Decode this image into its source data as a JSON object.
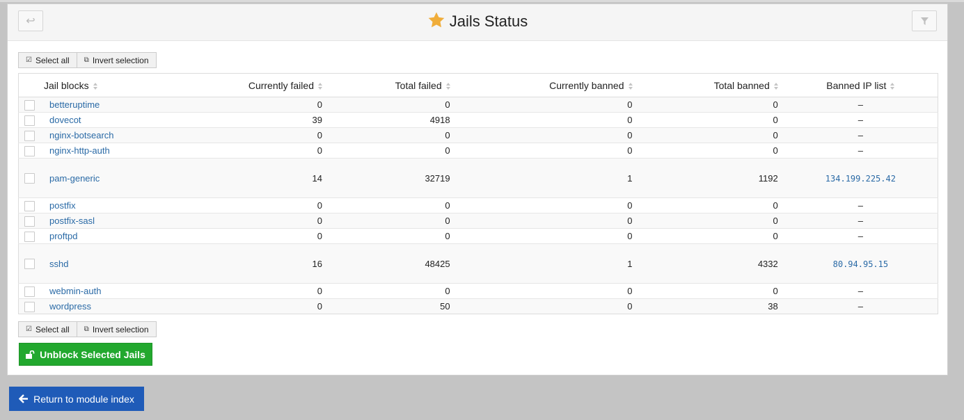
{
  "header": {
    "title": "Jails Status",
    "back_icon": "undo-arrow-icon",
    "filter_icon": "filter-icon",
    "title_icon": "star-icon",
    "star_color": "#f0ad3a"
  },
  "selection": {
    "select_all": "Select all",
    "invert": "Invert selection"
  },
  "table": {
    "columns": [
      "Jail blocks",
      "Currently failed",
      "Total failed",
      "Currently banned",
      "Total banned",
      "Banned IP list"
    ],
    "rows": [
      {
        "name": "betteruptime",
        "cf": "0",
        "tf": "0",
        "cb": "0",
        "tb": "0",
        "ip": "–"
      },
      {
        "name": "dovecot",
        "cf": "39",
        "tf": "4918",
        "cb": "0",
        "tb": "0",
        "ip": "–"
      },
      {
        "name": "nginx-botsearch",
        "cf": "0",
        "tf": "0",
        "cb": "0",
        "tb": "0",
        "ip": "–"
      },
      {
        "name": "nginx-http-auth",
        "cf": "0",
        "tf": "0",
        "cb": "0",
        "tb": "0",
        "ip": "–"
      },
      {
        "name": "pam-generic",
        "cf": "14",
        "tf": "32719",
        "cb": "1",
        "tb": "1192",
        "ip": "134.199.225.42"
      },
      {
        "name": "postfix",
        "cf": "0",
        "tf": "0",
        "cb": "0",
        "tb": "0",
        "ip": "–"
      },
      {
        "name": "postfix-sasl",
        "cf": "0",
        "tf": "0",
        "cb": "0",
        "tb": "0",
        "ip": "–"
      },
      {
        "name": "proftpd",
        "cf": "0",
        "tf": "0",
        "cb": "0",
        "tb": "0",
        "ip": "–"
      },
      {
        "name": "sshd",
        "cf": "16",
        "tf": "48425",
        "cb": "1",
        "tb": "4332",
        "ip": "80.94.95.15"
      },
      {
        "name": "webmin-auth",
        "cf": "0",
        "tf": "0",
        "cb": "0",
        "tb": "0",
        "ip": "–"
      },
      {
        "name": "wordpress",
        "cf": "0",
        "tf": "50",
        "cb": "0",
        "tb": "38",
        "ip": "–"
      }
    ]
  },
  "actions": {
    "unblock": "Unblock Selected Jails",
    "unblock_color": "#22a82e",
    "return": "Return to module index",
    "return_color": "#1f5bb8"
  }
}
